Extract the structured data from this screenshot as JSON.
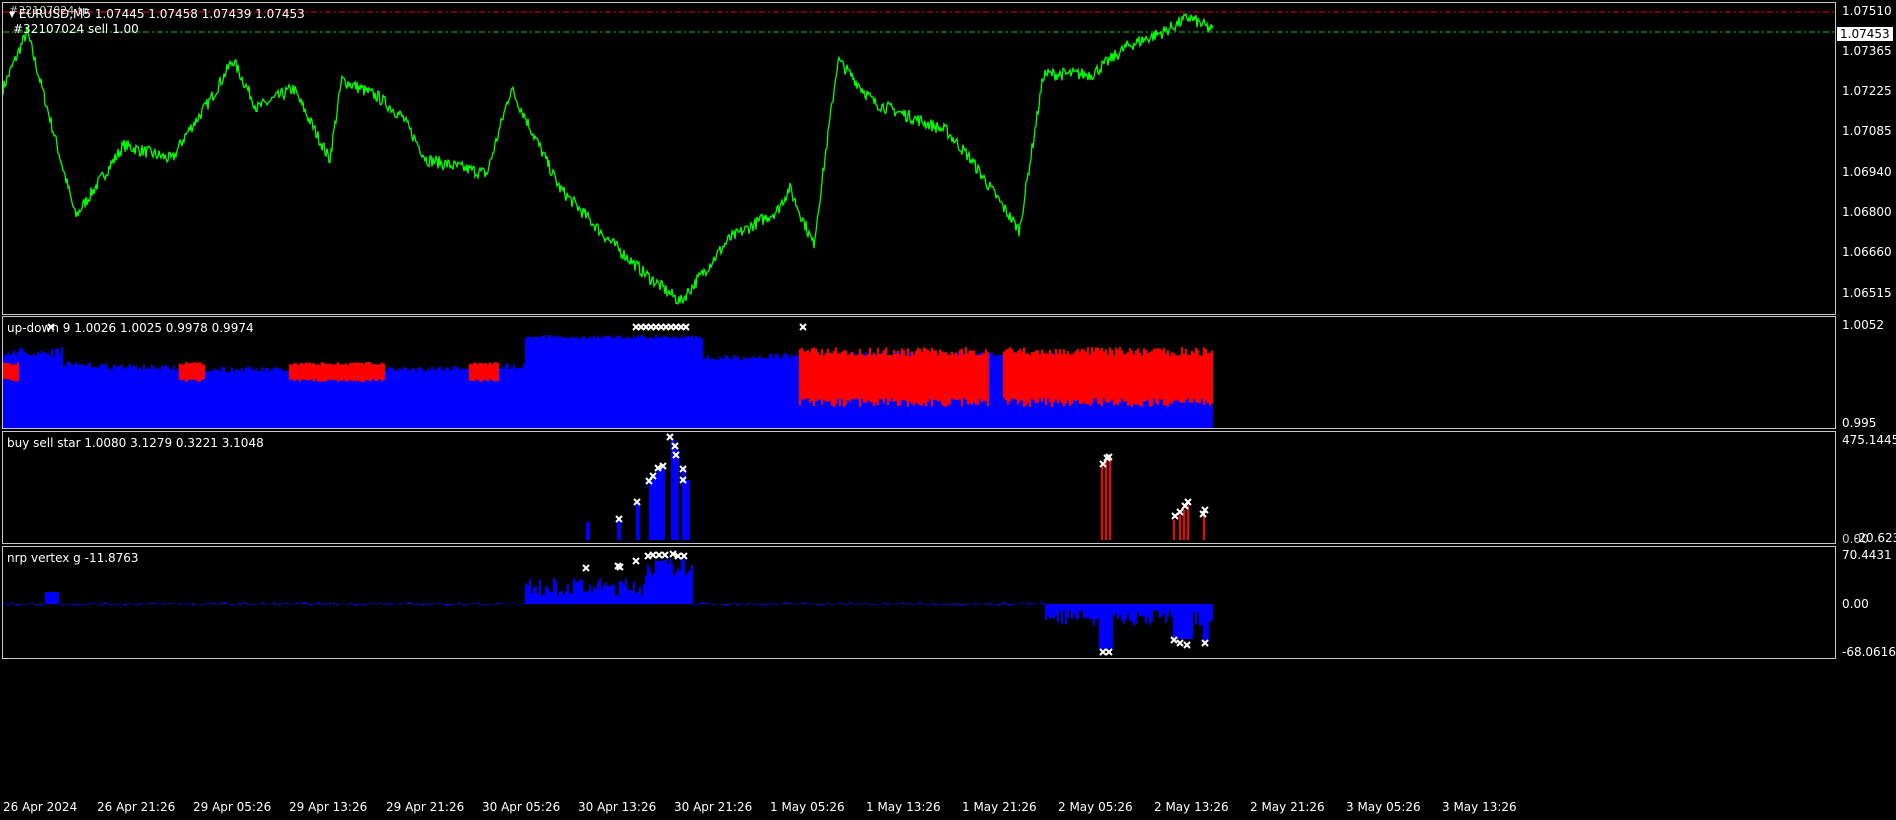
{
  "chart_header": {
    "symbol": "EURUSD,M5",
    "ohlc": "1.07445 1.07458 1.07439 1.07453",
    "order_label": "#32107024 sell 1.00",
    "overlap_label": "#32107024 tp"
  },
  "main_scale": [
    "1.07510",
    "1.07365",
    "1.07225",
    "1.07085",
    "1.06940",
    "1.06800",
    "1.06660",
    "1.06515"
  ],
  "main_price_tag": "1.07453",
  "panes": {
    "updown": {
      "label": "up-down 9 1.0026 1.0025 0.9978 0.9974",
      "scale_top": "1.0052",
      "scale_bottom": "0.995"
    },
    "buysell": {
      "label": "buy sell star 1.0080 3.1279 0.3221 3.1048",
      "scale_top": "475.1445",
      "scale_bottom": "0.00",
      "scale_bottom_overlap": "-20.6236"
    },
    "nrp": {
      "label": "nrp vertex g -11.8763",
      "scale_top": "70.4431",
      "scale_mid": "0.00",
      "scale_bottom": "-68.0616"
    }
  },
  "time_axis": [
    "26 Apr 2024",
    "26 Apr 21:26",
    "29 Apr 05:26",
    "29 Apr 13:26",
    "29 Apr 21:26",
    "30 Apr 05:26",
    "30 Apr 13:26",
    "30 Apr 21:26",
    "1 May 05:26",
    "1 May 13:26",
    "1 May 21:26",
    "2 May 05:26",
    "2 May 13:26",
    "2 May 21:26",
    "3 May 05:26",
    "3 May 13:26"
  ],
  "colors": {
    "price_line": "#00ff00",
    "up": "#0000ff",
    "down": "#ff0000",
    "marker": "#ffffff",
    "tp_line": "#ff0000",
    "bid_line": "#00cc00",
    "grid": "#c8c8c8"
  },
  "chart_data": {
    "type": "line",
    "title": "EURUSD,M5",
    "ylim": [
      1.0645,
      1.0755
    ],
    "anchors_x": [
      0,
      0.02,
      0.06,
      0.1,
      0.14,
      0.15,
      0.17,
      0.19,
      0.21,
      0.24,
      0.27,
      0.28,
      0.31,
      0.33,
      0.35,
      0.4,
      0.42,
      0.46,
      0.5,
      0.53,
      0.56,
      0.6,
      0.64,
      0.65,
      0.67,
      0.69,
      0.72,
      0.75,
      0.78,
      0.8,
      0.84,
      0.86,
      0.9,
      0.93,
      0.96,
      0.98,
      1.0
    ],
    "anchors_y": [
      1.0725,
      1.0745,
      1.068,
      1.0705,
      1.07,
      1.0708,
      1.072,
      1.0735,
      1.0718,
      1.0725,
      1.07,
      1.0728,
      1.0722,
      1.0715,
      1.07,
      1.0695,
      1.0725,
      1.069,
      1.0672,
      1.066,
      1.065,
      1.0672,
      1.0682,
      1.069,
      1.067,
      1.0735,
      1.072,
      1.0715,
      1.071,
      1.07,
      1.0675,
      1.073,
      1.073,
      1.074,
      1.0745,
      1.075,
      1.07453
    ]
  }
}
